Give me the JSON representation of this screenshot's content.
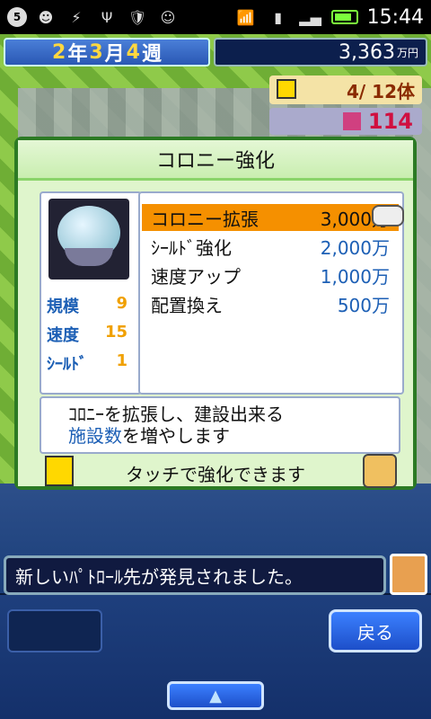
{
  "status_bar": {
    "notification_count": "5",
    "time": "15:44"
  },
  "hud": {
    "date": {
      "year": "2",
      "year_unit": "年",
      "month": "3",
      "month_unit": "月",
      "week": "4",
      "week_unit": "週"
    },
    "money": "3,363",
    "money_unit": "万円",
    "population": "4/ 12体",
    "points": "114"
  },
  "dialog": {
    "title": "コロニー強化",
    "stats": [
      {
        "label": "規模",
        "value": "9"
      },
      {
        "label": "速度",
        "value": "15"
      },
      {
        "label": "ｼｰﾙﾄﾞ",
        "value": "1"
      }
    ],
    "options": [
      {
        "label": "コロニー拡張",
        "price": "3,000万",
        "selected": true
      },
      {
        "label": "ｼｰﾙﾄﾞ強化",
        "price": "2,000万",
        "selected": false
      },
      {
        "label": "速度アップ",
        "price": "1,000万",
        "selected": false
      },
      {
        "label": "配置換え",
        "price": "500万",
        "selected": false
      }
    ],
    "description_line1": "ｺﾛﾆｰを拡張し、建設出来る",
    "description_hl": "施設数",
    "description_line2_rest": "を増やします",
    "hint": "タッチで強化できます"
  },
  "message": "新しいﾊﾟﾄﾛｰﾙ先が発見されました。",
  "buttons": {
    "back": "戻る",
    "up": "▲"
  }
}
